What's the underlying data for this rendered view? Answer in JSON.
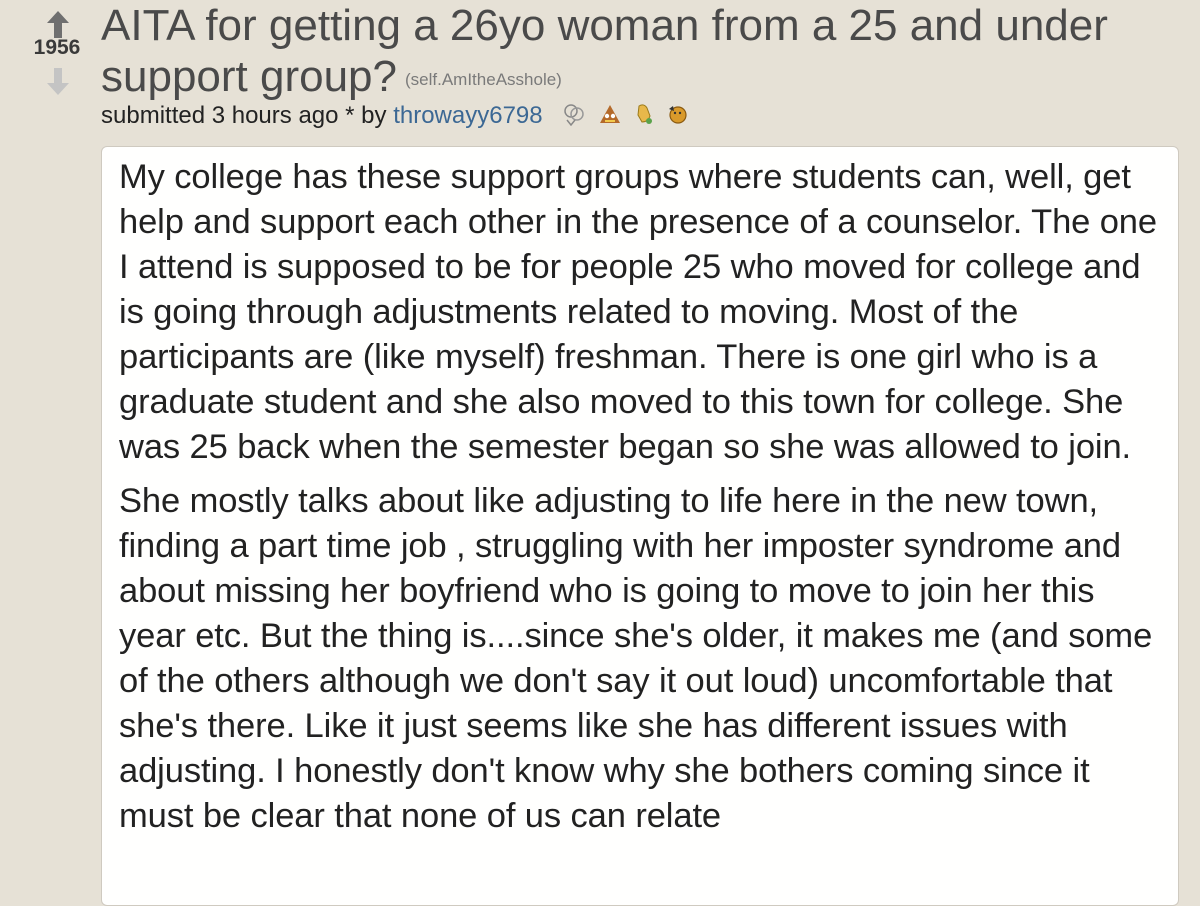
{
  "post": {
    "score": "1956",
    "title": "AITA for getting a 26yo woman from a 25 and under support group?",
    "domain": "(self.AmItheAsshole)",
    "tagline": {
      "submitted": "submitted 3 hours ago * by",
      "author": "throwayy6798"
    },
    "body": [
      "My college has these support groups where students can, well, get help and support each other in the presence of a counselor. The one I attend is supposed to be for people 25 who moved for college and is going through adjustments related to moving. Most of the participants are (like myself) freshman. There is one girl who is a graduate student and she also moved to this town for college. She was 25 back when the semester began so she was allowed to join.",
      "She mostly talks about like adjusting to life here in the new town, finding a part time job , struggling with her imposter syndrome and about missing her boyfriend who is going to move to join her this year etc. But the thing is....since she's older, it makes me (and some of the others although we don't say it out loud) uncomfortable that she's there. Like it just seems like she has different issues with adjusting. I honestly don't know why she bothers coming since it must be clear that none of us can relate"
    ]
  },
  "icons": {
    "upvote": "upvote-arrow-icon",
    "downvote": "downvote-arrow-icon",
    "awards": [
      "silver-award-icon",
      "gold-award-icon",
      "helpful-award-icon",
      "wholesome-award-icon"
    ]
  },
  "colors": {
    "background": "#e6e1d6",
    "author_link": "#3c6894",
    "body_bg": "#fffffe"
  }
}
